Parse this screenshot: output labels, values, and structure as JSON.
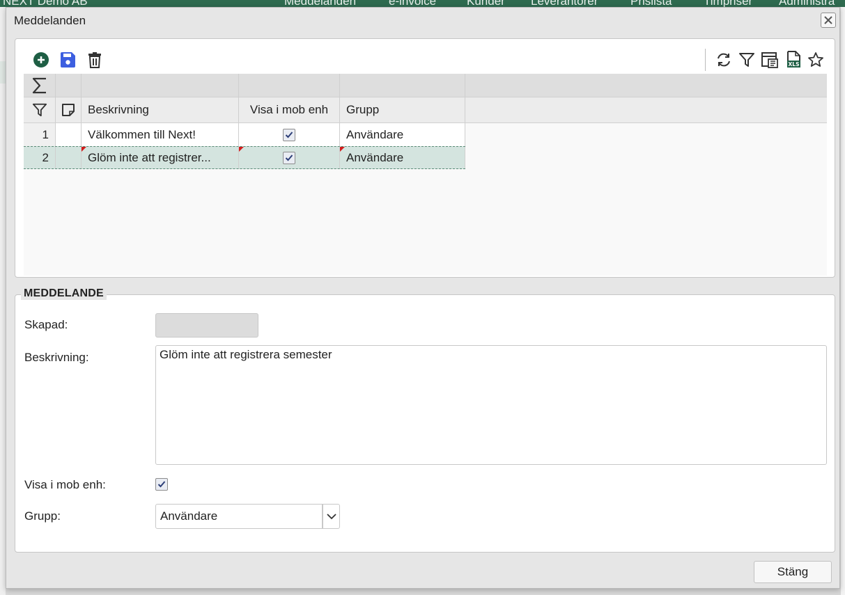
{
  "app": {
    "brand": "NEXT Demo AB",
    "nav": [
      "Meddelanden",
      "e-invoice",
      "Kunder",
      "Leverantörer",
      "Prislista",
      "Timpriser",
      "Administra"
    ]
  },
  "dialog": {
    "title": "Meddelanden",
    "close_icon": "close-icon"
  },
  "toolbar": {
    "left_icons": [
      "add-icon",
      "save-icon",
      "delete-icon"
    ],
    "right_icons": [
      "refresh-icon",
      "filter-icon",
      "export-icon",
      "xls-icon",
      "favorite-icon"
    ]
  },
  "grid": {
    "columns": [
      "Beskrivning",
      "Visa i mob enh",
      "Grupp"
    ],
    "rows": [
      {
        "num": "1",
        "desc": "Välkommen till Next!",
        "mob": true,
        "group": "Användare"
      },
      {
        "num": "2",
        "desc": "Glöm inte att registrer...",
        "mob": true,
        "group": "Användare"
      }
    ]
  },
  "form": {
    "legend": "MEDDELANDE",
    "created_label": "Skapad:",
    "created_value": "",
    "description_label": "Beskrivning:",
    "description_value": "Glöm inte att registrera semester",
    "mobile_label": "Visa i mob enh:",
    "mobile_checked": true,
    "group_label": "Grupp:",
    "group_value": "Användare"
  },
  "footer": {
    "close_label": "Stäng"
  },
  "colors": {
    "accent_green": "#1e5e44",
    "save_blue": "#3d5fe0",
    "selected_row": "#d4e4df"
  }
}
